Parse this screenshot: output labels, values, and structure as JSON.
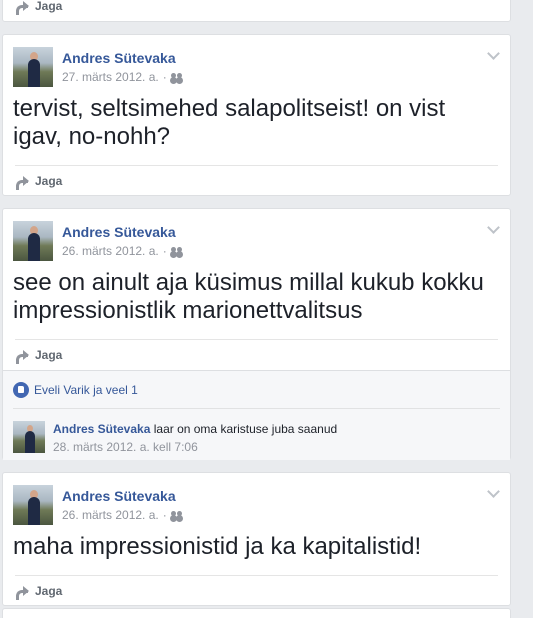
{
  "share_label": "Jaga",
  "posts": [
    {
      "author": "Andres Sütevaka",
      "date": "27. märts 2012. a.",
      "sep": "·",
      "text": "tervist, seltsimehed salapolitseist! on vist igav, no-nohh?"
    },
    {
      "author": "Andres Sütevaka",
      "date": "26. märts 2012. a.",
      "sep": "·",
      "text": "see on ainult aja küsimus millal kukub kokku impressionistlik marionettvalitsus",
      "reactions": "Eveli Varik ja veel 1",
      "comment": {
        "author": "Andres Sütevaka",
        "text": "laar on oma karistuse juba saanud",
        "time": "28. märts 2012. a. kell 7:06"
      }
    },
    {
      "author": "Andres Sütevaka",
      "date": "26. märts 2012. a.",
      "sep": "·",
      "text": "maha impressionistid ja ka kapitalistid!"
    }
  ],
  "icons": {
    "share": "share-arrow-icon",
    "audience": "friends-icon",
    "menu": "chevron-down-icon",
    "like": "like-icon"
  },
  "colors": {
    "link": "#365899",
    "muted": "#90949c",
    "background": "#e9ebee"
  }
}
